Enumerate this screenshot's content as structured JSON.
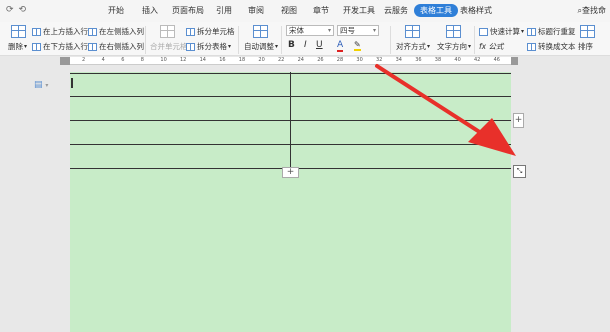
{
  "quick_access": {
    "redo_icon": "⟳",
    "undo_icon": "⟲"
  },
  "menu": {
    "tabs": [
      "开始",
      "插入",
      "页面布局",
      "引用",
      "审阅",
      "视图",
      "章节",
      "开发工具",
      "云服务",
      "表格工具",
      "表格样式"
    ],
    "active_tab": "表格工具",
    "find_label": "查找命"
  },
  "ribbon": {
    "delete_label": "删除",
    "insert_row_above": "在上方插入行",
    "insert_row_below": "在下方插入行",
    "insert_col_left": "在左侧插入列",
    "insert_col_right": "在右侧插入列",
    "merge_cells": "合并单元格",
    "split_cells": "拆分单元格",
    "split_table": "拆分表格",
    "auto_fit": "自动调整",
    "font_name": "宋体",
    "font_size": "四号",
    "bold": "B",
    "italic": "I",
    "underline": "U",
    "font_color": "A",
    "align": "对齐方式",
    "text_direction": "文字方向",
    "quick_calc": "快速计算",
    "formula": "fx 公式",
    "repeat_header": "标题行重复",
    "convert_text": "转换成文本",
    "sort": "排序"
  },
  "ruler": {
    "ticks": [
      "2",
      "4",
      "6",
      "8",
      "10",
      "12",
      "14",
      "16",
      "18",
      "20",
      "22",
      "24",
      "26",
      "28",
      "30",
      "32",
      "34",
      "36",
      "38",
      "40",
      "42",
      "46"
    ]
  },
  "table": {
    "rows": 4,
    "cols": 2
  },
  "controls": {
    "add_column": "+",
    "add_row": "+",
    "resize_handle": "⤡"
  },
  "colors": {
    "page_bg": "#c8ecc8",
    "arrow": "#e8302a",
    "active_tab": "#2f7fd8"
  }
}
